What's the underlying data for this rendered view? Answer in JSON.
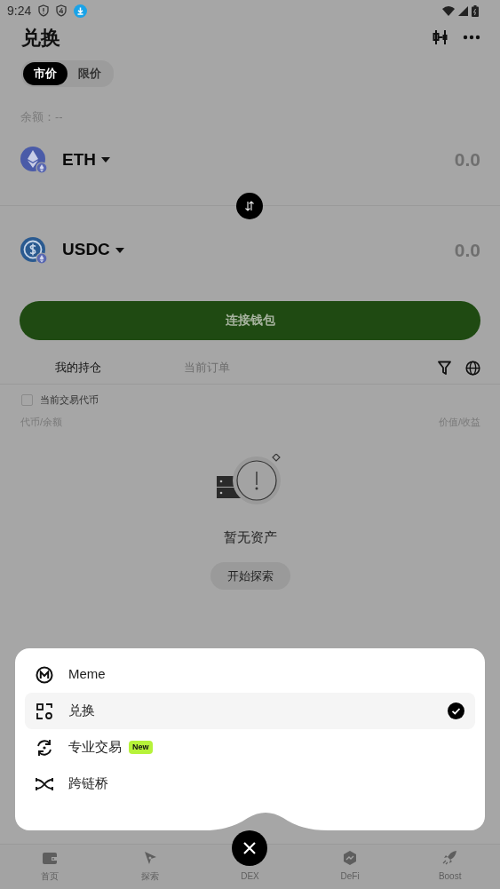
{
  "status_bar": {
    "time": "9:24"
  },
  "header": {
    "title": "兑换"
  },
  "order_tabs": [
    {
      "label": "市价",
      "selected": true
    },
    {
      "label": "限价",
      "selected": false
    }
  ],
  "balance": "余额：--",
  "tokens": [
    {
      "symbol": "ETH",
      "amount": "0.0",
      "kind": "eth"
    },
    {
      "symbol": "USDC",
      "amount": "0.0",
      "kind": "usdc"
    }
  ],
  "connect_button": "连接钱包",
  "holdings_tabs": [
    {
      "label": "我的持仓",
      "selected": true
    },
    {
      "label": "当前订单",
      "selected": false
    }
  ],
  "filter": {
    "label": "当前交易代币",
    "checked": false
  },
  "columns": [
    "代币/余额",
    "价值/收益"
  ],
  "empty_state": {
    "message": "暂无资产",
    "button": "开始探索"
  },
  "menu": [
    {
      "label": "Meme",
      "kind": "meme",
      "selected": false
    },
    {
      "label": "兑换",
      "kind": "swap",
      "selected": true
    },
    {
      "label": "专业交易",
      "kind": "pro",
      "selected": false,
      "badge": "New"
    },
    {
      "label": "跨链桥",
      "kind": "bridge",
      "selected": false
    }
  ],
  "bottom_nav": [
    {
      "label": "首页",
      "kind": "wallet"
    },
    {
      "label": "探索",
      "kind": "compass"
    },
    {
      "label": "DEX",
      "kind": "close"
    },
    {
      "label": "DeFi",
      "kind": "defi"
    },
    {
      "label": "Boost",
      "kind": "rocket"
    }
  ]
}
